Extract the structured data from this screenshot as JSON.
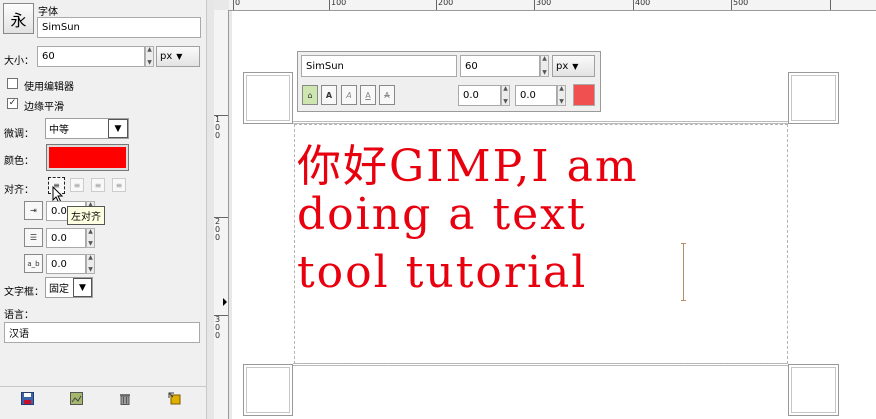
{
  "panel": {
    "font_label": "字体",
    "font_preview_glyph": "永",
    "font_value": "SimSun",
    "size_label": "大小：",
    "size_value": "60",
    "unit_value": "px",
    "use_editor_label": "使用编辑器",
    "antialias_label": "边缘平滑",
    "hinting_label": "微调：",
    "hinting_value": "中等",
    "color_label": "颜色：",
    "color_hex": "#ff0000",
    "justify_label": "对齐：",
    "indent_value": "0.0",
    "line_spacing_value": "0.0",
    "letter_spacing_value": "0.0",
    "letter_spacing_icon_text": "a_b",
    "box_label": "文字框：",
    "box_value": "固定",
    "language_label": "语言：",
    "language_value": "汉语",
    "tooltip": "左对齐"
  },
  "rulers": {
    "top_labels": [
      "0",
      "100",
      "200",
      "300",
      "400",
      "500"
    ],
    "left_labels": [
      "100",
      "200",
      "300"
    ]
  },
  "style_editor": {
    "font_value": "SimSun",
    "size_value": "60",
    "unit_value": "px",
    "baseline_value": "0.0",
    "kerning_value": "0.0",
    "color_hex": "#f05050"
  },
  "canvas": {
    "text_lines": [
      "你好GIMP,I am",
      "doing a text",
      "tool tutorial"
    ],
    "text_color": "#e8000f"
  }
}
